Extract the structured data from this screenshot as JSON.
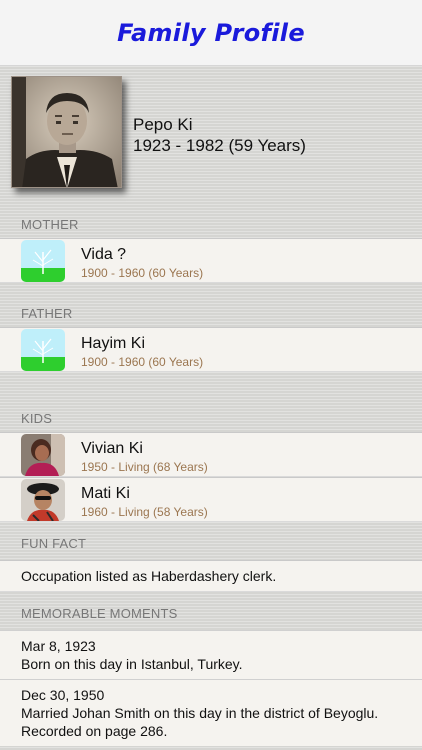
{
  "header": {
    "title": "Family Profile"
  },
  "profile": {
    "name": "Pepo Ki",
    "dates": "1923 - 1982 (59 Years)",
    "photo": "sepia-portrait"
  },
  "sections": {
    "mother": {
      "label": "MOTHER",
      "person": {
        "name": "Vida ?",
        "dates": "1900 - 1960 (60 Years)",
        "icon": "tree-placeholder-icon"
      }
    },
    "father": {
      "label": "FATHER",
      "person": {
        "name": "Hayim Ki",
        "dates": "1900 - 1960 (60 Years)",
        "icon": "tree-placeholder-icon"
      }
    },
    "kids": {
      "label": "KIDS",
      "people": [
        {
          "name": "Vivian Ki",
          "dates": "1950 - Living (68 Years)",
          "icon": "avatar-photo"
        },
        {
          "name": "Mati Ki",
          "dates": "1960 - Living (58 Years)",
          "icon": "avatar-photo"
        }
      ]
    },
    "fun_fact": {
      "label": "FUN FACT",
      "text": "Occupation listed as Haberdashery clerk."
    },
    "moments": {
      "label": "MEMORABLE MOMENTS",
      "items": [
        {
          "date": "Mar 8, 1923",
          "text": "Born on this day in Istanbul, Turkey."
        },
        {
          "date": "Dec 30, 1950",
          "text": "Married Johan Smith on this day in the district of Beyoglu.  Recorded on page 286."
        }
      ]
    }
  },
  "colors": {
    "title": "#1a1adb",
    "dates": "#9b7650",
    "background": "#dcdcd9",
    "row": "#f5f3ef"
  }
}
